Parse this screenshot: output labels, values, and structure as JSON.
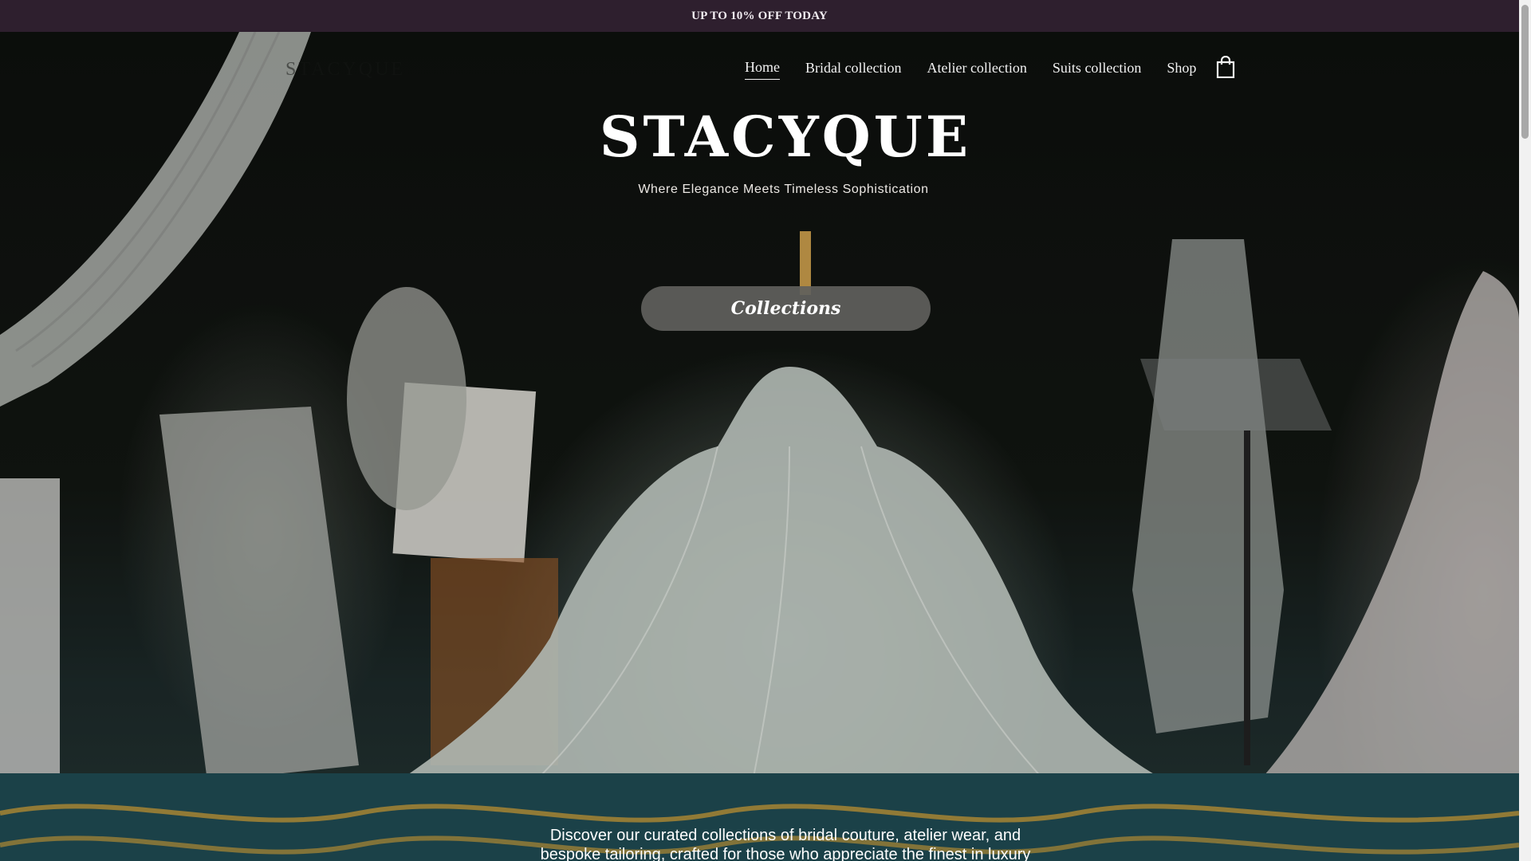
{
  "promo": {
    "text": "UP TO 10% OFF TODAY"
  },
  "header": {
    "logo": "STACYQUE",
    "nav": [
      {
        "label": "Home",
        "active": true
      },
      {
        "label": "Bridal collection",
        "active": false
      },
      {
        "label": "Atelier collection",
        "active": false
      },
      {
        "label": "Suits collection",
        "active": false
      },
      {
        "label": "Shop",
        "active": false
      }
    ],
    "cart_icon": "shopping-bag-icon"
  },
  "hero": {
    "title": "STACYQUE",
    "tagline": "Where Elegance Meets Timeless Sophistication",
    "cta_label": "Collections",
    "intro": "Discover our curated collections of bridal couture, atelier wear, and bespoke tailoring, crafted for those who appreciate the finest in luxury fashion."
  },
  "colors": {
    "promo_bg": "#2e1f2e",
    "cta_bg": "#5f605c",
    "text_light": "#ffffff"
  }
}
